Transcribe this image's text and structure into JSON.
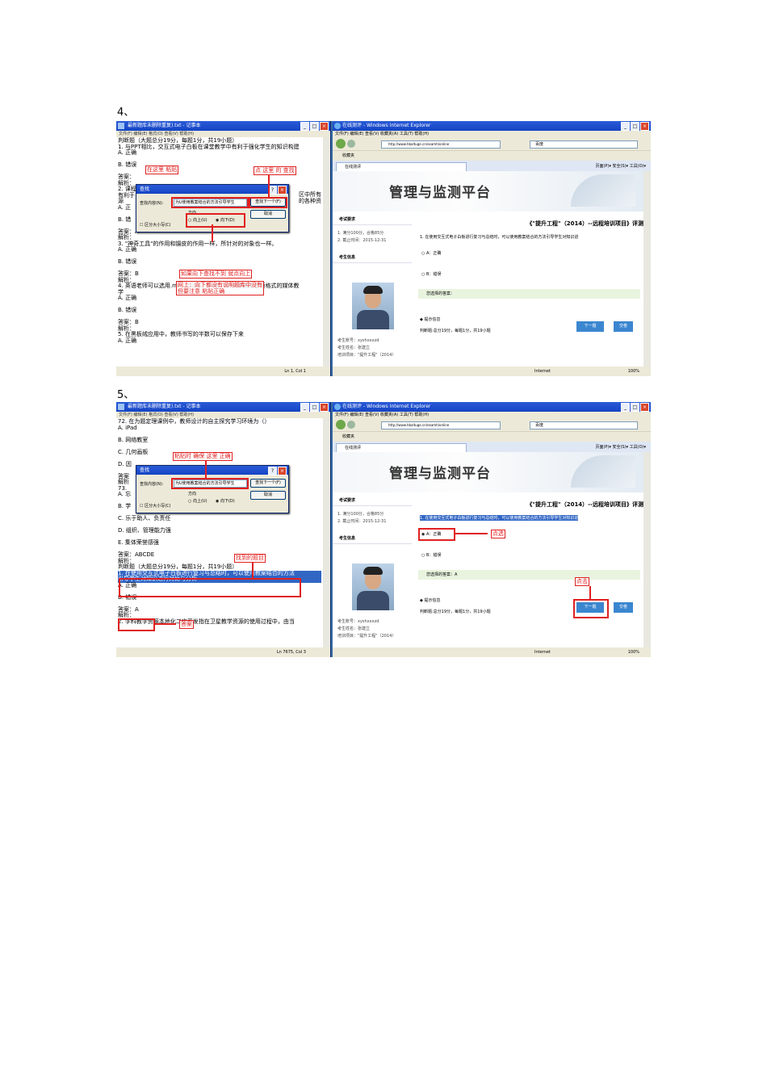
{
  "steps": [
    {
      "label": "4、",
      "notepad": {
        "title": "最新题库未删除重复).txt - 记事本",
        "menu": "文件(F)   编辑(E)   格式(O)   查看(V)   帮助(H)",
        "lines": [
          "判断题（大题总分19分，每题1分，共19小题）",
          "1. 与PPT相比，交互式电子白板在课堂教学中有利于强化学生的知识构建",
          "A. 正确",
          "",
          "B. 错误",
          "",
          "答案：",
          "解析：",
          "2. 课程",
          "有利于",
          "源",
          "A. 正",
          "",
          "B. 错",
          "",
          "答案：A",
          "解析：",
          "3. \"神奇工具\"的作用和镊皮的作用一样，所针对的对象也一样。",
          "A. 正确",
          "",
          "B. 错误",
          "",
          "答案：B",
          "解析：",
          "4. 英语老师可以选用.rm、.mp3、.mid、.wav等这些音频格式的媒体教",
          "学",
          "A. 正确",
          "",
          "B. 错误",
          "",
          "答案：B",
          "解析：",
          "5. 在黑板绒应用中，教师书写的半数可以保存下来",
          "A. 正确"
        ],
        "side_fragments": [
          "区中所有",
          "的各种资"
        ],
        "status": "Ln 1, Col 1"
      },
      "find_dialog": {
        "title": "查找",
        "find_label": "查找内容(N):",
        "find_value": "为U使用教案结合的方法引导学生",
        "find_next": "查找下一个(F)",
        "cancel": "取消",
        "direction_label": "方向",
        "up": "向上(U)",
        "down": "向下(D)",
        "match_case": "区分大小写(C)"
      },
      "annotations": [
        "在这里 粘贴",
        "点 这里 的 查找",
        "如果向下查找不到 就点向上",
        "网上：向下都没有说明题库中没有",
        "但要注意 粘贴正确"
      ],
      "ie": {
        "title": "在线测评 - Windows Internet Explorer",
        "menu": "文件(F)   编辑(E)   查看(V)   收藏夹(A)   工具(T)   帮助(H)",
        "url": "http://www.hbaltuge.cn/examh/online",
        "search": "百度",
        "favorites": "收藏夹",
        "tab": "在线测评",
        "tools": "页面(P)▾  安全(S)▾  工具(O)▾",
        "banner": "管理与监测平台",
        "sidebar": {
          "exam_header": "考试要求",
          "exam_items": [
            "1. 满分100分，合格85分",
            "2. 截止时间：2015-12-31"
          ],
          "info_header": "考生信息",
          "info_items": [
            "考生账号：xyshxxxzd",
            "考生姓名：张建立",
            "培训项目：\"提升工程\"（2014）"
          ]
        },
        "main": {
          "title": "《\"提升工程\"（2014）--远程培训项目》评测",
          "question": "1. 在使用交互式电子白板进行复习与总结时，可以使用教案结合的方法引导学生对知识进",
          "options": [
            "A：正确",
            "B：错误"
          ],
          "answer": "您选择的答案：",
          "hint_title": "提示信息",
          "hint": "判断题:总分19分，每题1分，共19小题",
          "next": "下一题",
          "submit": "交卷"
        },
        "status": "Internet",
        "zoom": "100%"
      }
    },
    {
      "label": "5、",
      "notepad": {
        "title": "最新题库未删除重复).txt - 记事本",
        "menu": "文件(F)   编辑(E)   格式(O)   查看(V)   帮助(H)",
        "lines": [
          "72. 在为题定理课例中，教师设计的自主探究学习环境为（）",
          "A. iPad",
          "",
          "B. 网络教室",
          "",
          "C. 几何画板",
          "",
          "D. 因",
          "",
          "答案",
          "解析",
          "73.",
          "A. 忘",
          "",
          "B. 学",
          "",
          "C. 乐于助人、负责任",
          "",
          "D. 组织、管理能力强",
          "",
          "E. 集体荣誉感强",
          "",
          "答案：ABCDE",
          "解析：",
          "判断题（大题总分19分，每题1分，共19小题）",
          "1. 在使用交互式电子白板进行复习与总结时，可以使用教案结合的方法",
          "引导学生对知识进行对比与分析",
          "A. 正确",
          "",
          "B. 错误",
          "",
          "答案：A",
          "解析：",
          "2. 学科教学资源本地化二次开发指在卫星教学资源的使用过程中，由当"
        ],
        "status": "Ln 7675, Col 3"
      },
      "find_dialog": {
        "title": "查找",
        "find_label": "查找内容(N):",
        "find_value": "为U使用教案结合的方法引导学生",
        "find_next": "查找下一个(F)",
        "cancel": "取消",
        "direction_label": "方向",
        "up": "向上(U)",
        "down": "向下(D)",
        "match_case": "区分大小写(C)"
      },
      "annotations": [
        "粘贴时 确保 这里 正确",
        "找到的题目",
        "答案",
        "点选",
        "点击"
      ],
      "ie": {
        "title": "在线测评 - Windows Internet Explorer",
        "menu": "文件(F)   编辑(E)   查看(V)   收藏夹(A)   工具(T)   帮助(H)",
        "url": "http://www.hbaltuge.cn/examh/online",
        "search": "百度",
        "favorites": "收藏夹",
        "tab": "在线测评",
        "tools": "页面(P)▾  安全(S)▾  工具(O)▾",
        "banner": "管理与监测平台",
        "sidebar": {
          "exam_header": "考试要求",
          "exam_items": [
            "1. 满分100分，合格85分",
            "2. 截止时间：2015-12-31"
          ],
          "info_header": "考生信息",
          "info_items": [
            "考生账号：xyshxxxzd",
            "考生姓名：张建立",
            "培训项目：\"提升工程\"（2014）"
          ]
        },
        "main": {
          "title": "《\"提升工程\"（2014）--远程培训项目》评测",
          "question": "1. 在使用交互式电子白板进行复习与总结时，可以使用教案结合的方法引导学生对知识进",
          "options": [
            "A：正确",
            "B：错误"
          ],
          "answer": "您选择的答案：A",
          "hint_title": "提示信息",
          "hint": "判断题:总分19分，每题1分，共19小题",
          "next": "下一题",
          "submit": "交卷"
        },
        "status": "Internet",
        "zoom": "100%"
      }
    }
  ]
}
